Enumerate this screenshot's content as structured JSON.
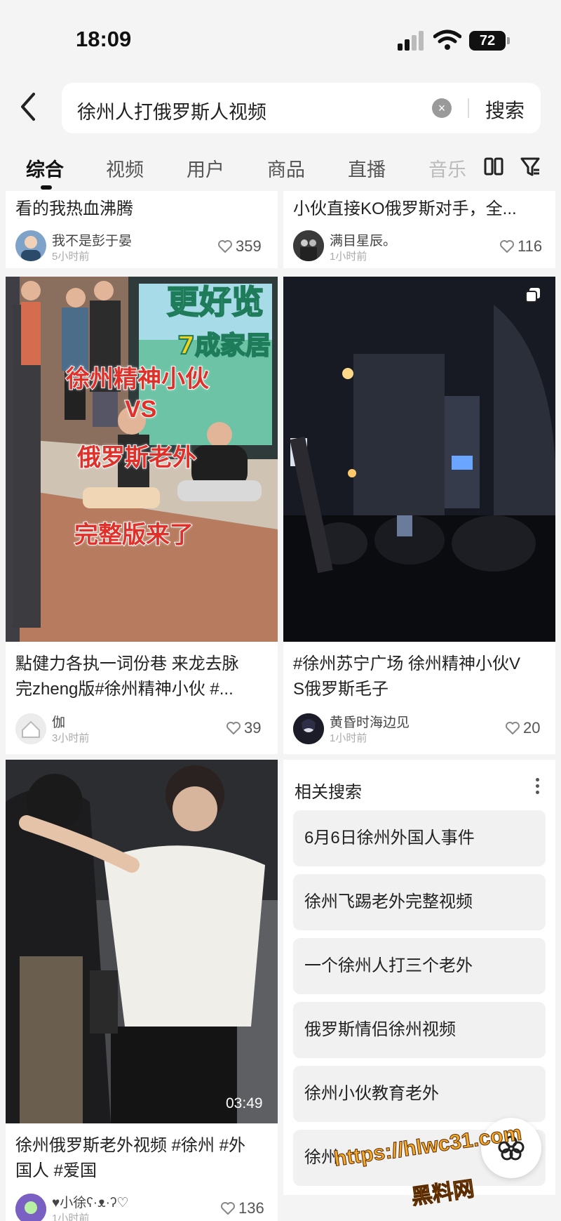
{
  "status_bar": {
    "time": "18:09",
    "battery": "72"
  },
  "search": {
    "query": "徐州人打俄罗斯人视频",
    "button_label": "搜索"
  },
  "tabs": [
    "综合",
    "视频",
    "用户",
    "商品",
    "直播",
    "音乐"
  ],
  "cards": [
    {
      "title": "看的我热血沸腾",
      "author": "我不是彭于晏",
      "ago": "5小时前",
      "likes": "359"
    },
    {
      "title": "小伙直接KO俄罗斯对手，全...",
      "author": "满目星辰。",
      "ago": "1小时前",
      "likes": "116"
    },
    {
      "title_line1": "點健力各执一词份巷  来龙去脉",
      "title_line2": "完zheng版#徐州精神小伙 #...",
      "author": "伽",
      "ago": "3小时前",
      "likes": "39",
      "cover_text": [
        "更好览",
        "7成家居",
        "徐州精神小伙",
        "VS",
        "俄罗斯老外",
        "完整版来了"
      ]
    },
    {
      "title_line1": "#徐州苏宁广场 徐州精神小伙V",
      "title_line2": "S俄罗斯毛子",
      "author": "黄昏时海边见",
      "ago": "1小时前",
      "likes": "20"
    },
    {
      "title_line1": "徐州俄罗斯老外视频 #徐州 #外",
      "title_line2": "国人 #爱国",
      "author": "♥小徐ʕ·ᴥ·ʔ♡",
      "ago": "1小时前",
      "likes": "136",
      "duration": "03:49"
    }
  ],
  "related": {
    "heading": "相关搜索",
    "items": [
      "6月6日徐州外国人事件",
      "徐州飞踢老外完整视频",
      "一个徐州人打三个老外",
      "俄罗斯情侣徐州视频",
      "徐州小伙教育老外",
      "徐州"
    ]
  },
  "watermark": {
    "line1": "https://hlwc31.com",
    "line2": "黑料网"
  }
}
